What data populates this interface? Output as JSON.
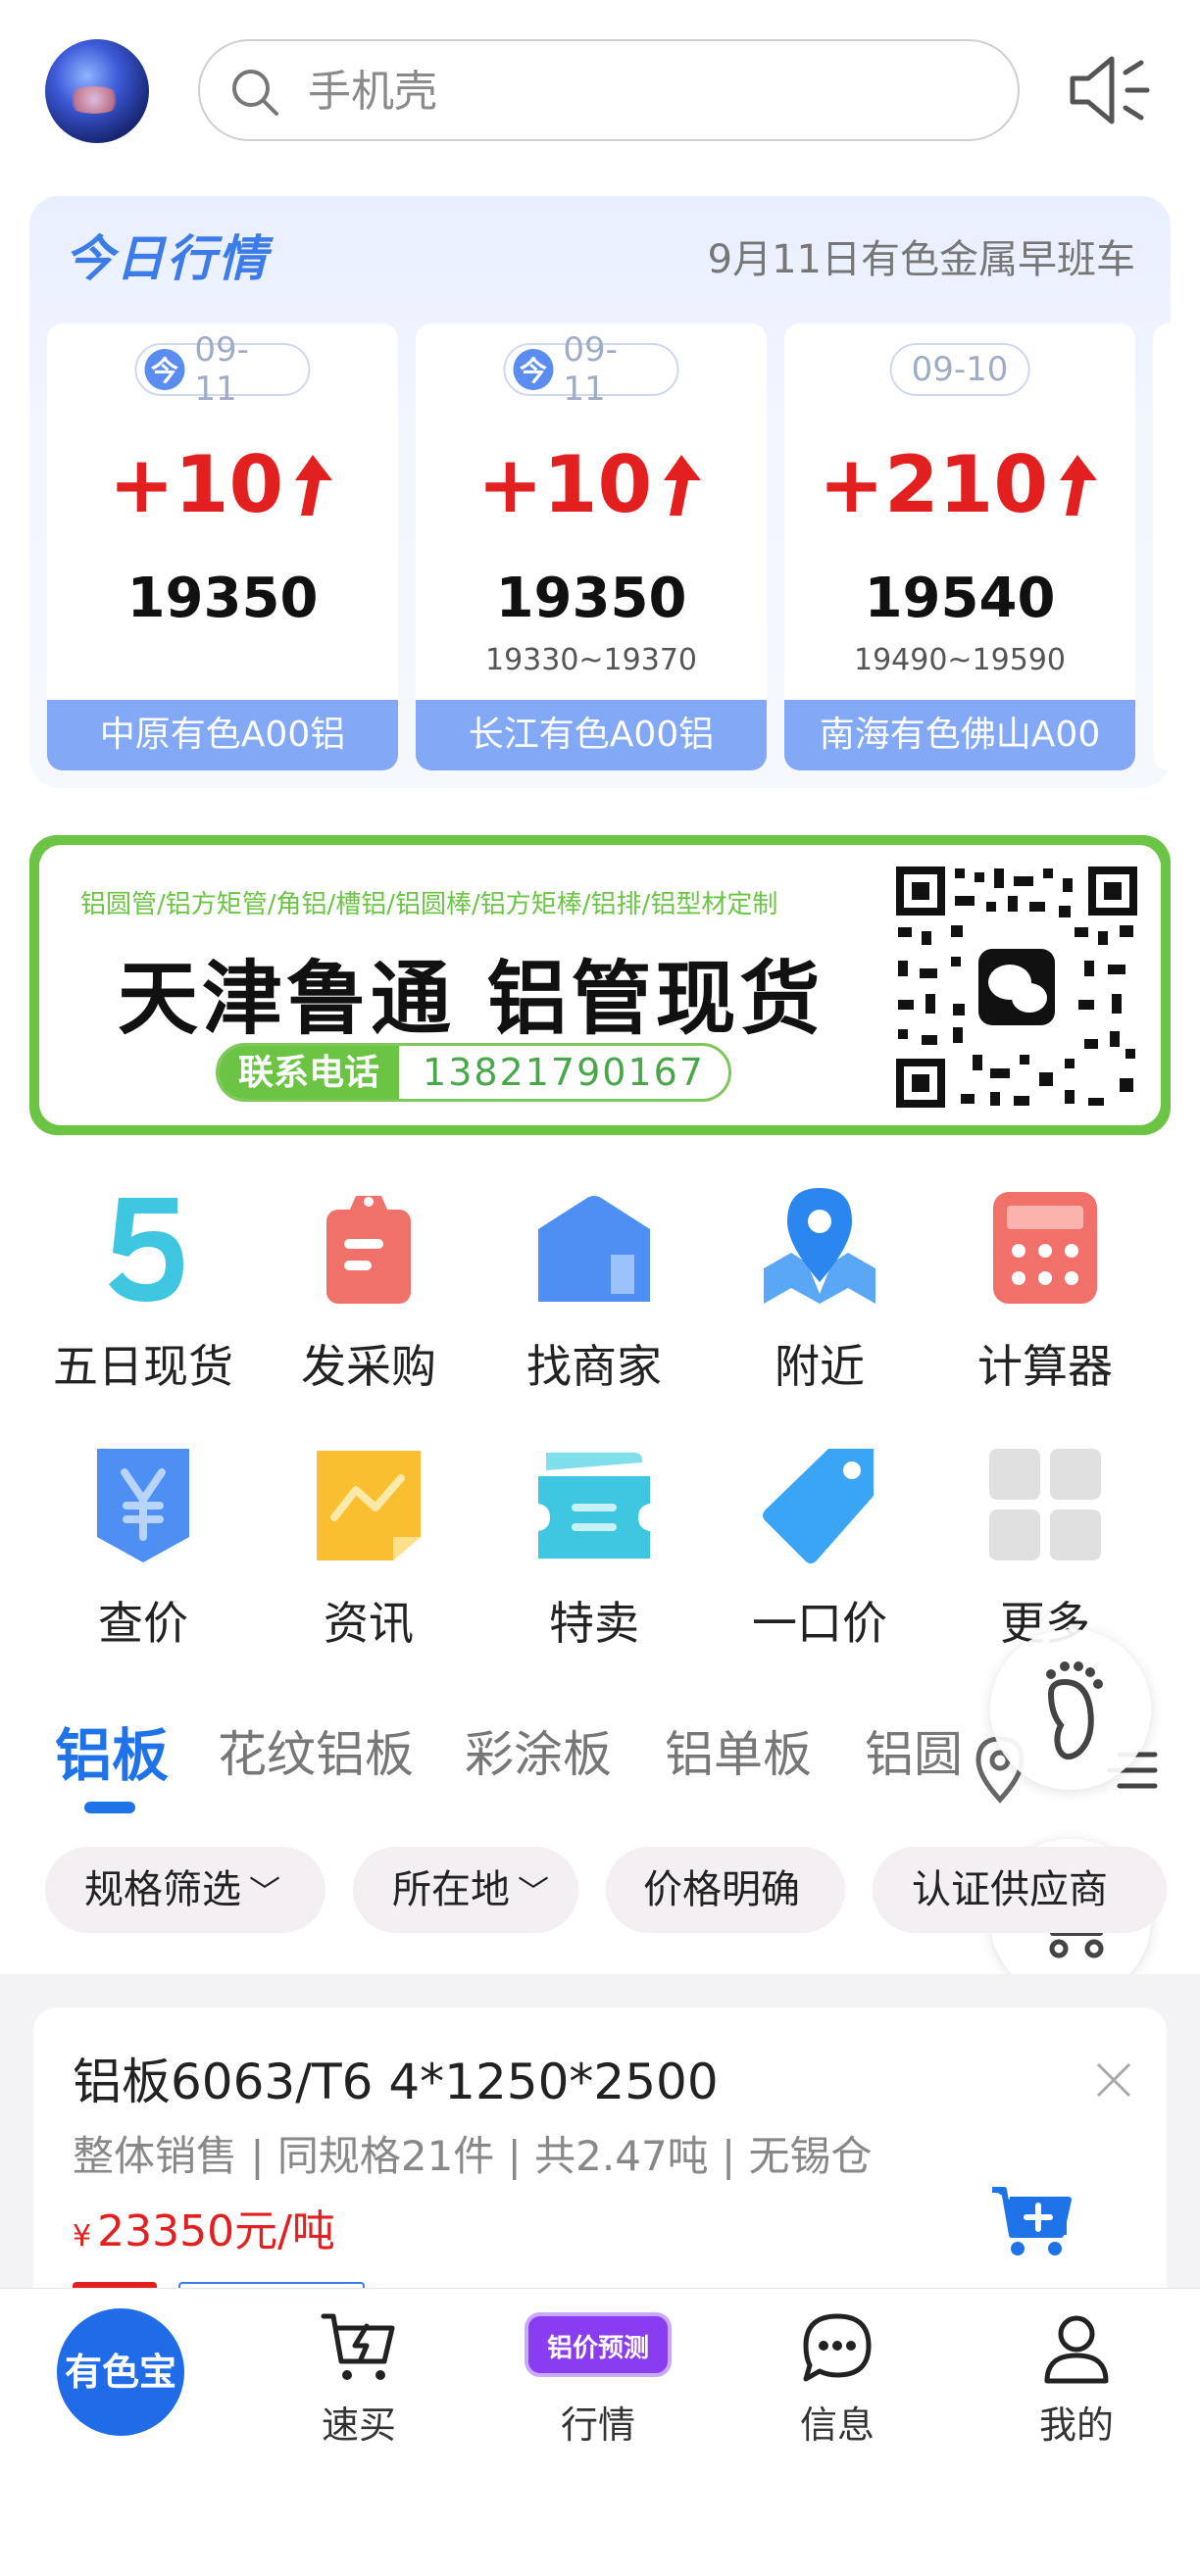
{
  "header": {
    "search_placeholder": "手机壳"
  },
  "market": {
    "title": "今日行情",
    "subtitle": "9月11日有色金属早班车",
    "cards": [
      {
        "tag": "今",
        "date": "09-11",
        "change": "+10",
        "price": "19350",
        "range": "",
        "name": "中原有色A00铝"
      },
      {
        "tag": "今",
        "date": "09-11",
        "change": "+10",
        "price": "19350",
        "range": "19330~19370",
        "name": "长江有色A00铝"
      },
      {
        "tag": "",
        "date": "09-10",
        "change": "+210",
        "price": "19540",
        "range": "19490~19590",
        "name": "南海有色佛山A00"
      }
    ],
    "colors": {
      "up": "#e32020",
      "card_footer": "#83a8f5",
      "accent": "#3c7be8"
    }
  },
  "banner": {
    "tags": "铝圆管/铝方矩管/角铝/槽铝/铝圆棒/铝方矩棒/铝排/铝型材定制",
    "title": "天津鲁通 铝管现货",
    "phone_label": "联系电话",
    "phone_number": "13821790167",
    "accent": "#6cc445"
  },
  "grid": [
    {
      "label": "五日现货",
      "icon": "five-icon"
    },
    {
      "label": "发采购",
      "icon": "clipboard-icon"
    },
    {
      "label": "找商家",
      "icon": "shop-icon"
    },
    {
      "label": "附近",
      "icon": "map-pin-icon"
    },
    {
      "label": "计算器",
      "icon": "calculator-icon"
    },
    {
      "label": "查价",
      "icon": "yen-shield-icon"
    },
    {
      "label": "资讯",
      "icon": "news-icon"
    },
    {
      "label": "特卖",
      "icon": "ticket-icon"
    },
    {
      "label": "一口价",
      "icon": "price-tag-icon"
    },
    {
      "label": "更多",
      "icon": "more-grid-icon"
    }
  ],
  "tabs": [
    "铝板",
    "花纹铝板",
    "彩涂板",
    "铝单板",
    "铝圆"
  ],
  "filters": [
    "规格筛选",
    "所在地",
    "价格明确",
    "认证供应商"
  ],
  "listing": {
    "title": "铝板6063/T6 4*1250*2500",
    "meta": "整体销售 | 同规格21件 | 共2.47吨 | 无锡仓",
    "price_symbol": "¥",
    "price": "23350元/吨"
  },
  "bottom_nav": {
    "home": "有色宝",
    "items": [
      {
        "label": "速买",
        "icon": "cart-flash-icon"
      },
      {
        "label": "行情",
        "icon": "promo-badge",
        "badge": "铝价预测"
      },
      {
        "label": "信息",
        "icon": "chat-icon"
      },
      {
        "label": "我的",
        "icon": "user-icon"
      }
    ]
  }
}
